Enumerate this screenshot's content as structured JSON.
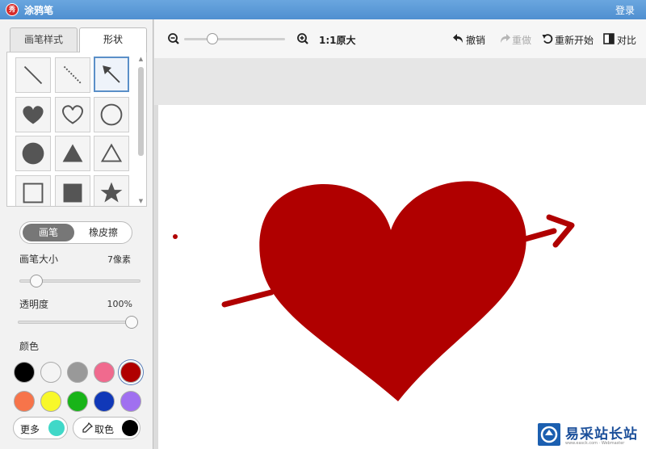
{
  "app": {
    "title": "涂鸦笔",
    "logo_text": "秀",
    "login": "登录"
  },
  "tabs": {
    "brush_style": "画笔样式",
    "shapes": "形状"
  },
  "shapes": [
    {
      "name": "line",
      "selected": false
    },
    {
      "name": "dashed-line",
      "selected": false
    },
    {
      "name": "arrow",
      "selected": true
    },
    {
      "name": "filled-heart",
      "selected": false
    },
    {
      "name": "outline-heart",
      "selected": false
    },
    {
      "name": "outline-circle",
      "selected": false
    },
    {
      "name": "filled-circle",
      "selected": false
    },
    {
      "name": "filled-triangle",
      "selected": false
    },
    {
      "name": "outline-triangle",
      "selected": false
    },
    {
      "name": "outline-square",
      "selected": false
    },
    {
      "name": "filled-square",
      "selected": false
    },
    {
      "name": "filled-star",
      "selected": false
    }
  ],
  "mode": {
    "brush": "画笔",
    "eraser": "橡皮擦",
    "active": "brush"
  },
  "brush_size": {
    "label": "画笔大小",
    "value": "7像素",
    "level": 0.1
  },
  "opacity": {
    "label": "透明度",
    "value": "100%",
    "level": 1.0
  },
  "colors": {
    "label": "颜色",
    "selected": "#b00000",
    "swatches": [
      "#000000",
      "#f4f4f4",
      "#999999",
      "#f06a8e",
      "#b00000",
      "#f7744a",
      "#f8f82a",
      "#18b418",
      "#1038b8",
      "#a070f0"
    ]
  },
  "more_colors": {
    "label": "更多",
    "color": "#40d8c8"
  },
  "eyedropper": {
    "label": "取色",
    "color": "#000000"
  },
  "toolbar": {
    "zoom_level": 0.25,
    "actual_size": "1:1原大",
    "undo": "撤销",
    "redo": "重做",
    "restart": "重新开始",
    "compare": "对比"
  },
  "canvas": {
    "stroke_color": "#b00000"
  },
  "watermark": {
    "title": "易采站长站",
    "subtitle": "www.easck.com · Webmaster"
  }
}
